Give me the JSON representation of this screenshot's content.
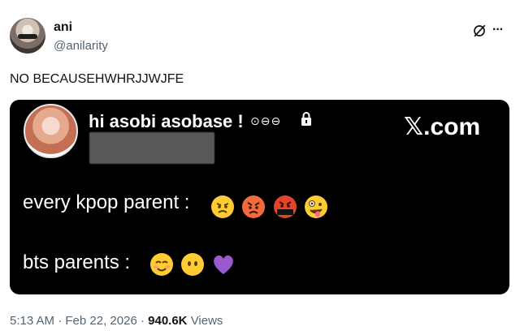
{
  "author": {
    "name": "ani",
    "handle": "@anilarity"
  },
  "tweet": {
    "text": "NO BECAUSEHWHRJJWJFE"
  },
  "card": {
    "display_name": "hi asobi asobase !",
    "status_icons": "⊙⊖⊖",
    "x_label": "𝕏.com",
    "line1": "every kpop parent :",
    "line2": "bts parents :",
    "emoji1": [
      "annoyed-face",
      "angry-face",
      "cursing-face",
      "zany-face"
    ],
    "emoji2": [
      "smiling-face",
      "no-mouth-face",
      "purple-heart"
    ]
  },
  "meta": {
    "time": "5:13 AM",
    "sep": "·",
    "date": "Feb 22, 2026",
    "views": "940.6K",
    "views_label": "Views"
  },
  "colors": {
    "text": "#0f1419",
    "secondary": "#536471",
    "card_bg": "#000000"
  }
}
